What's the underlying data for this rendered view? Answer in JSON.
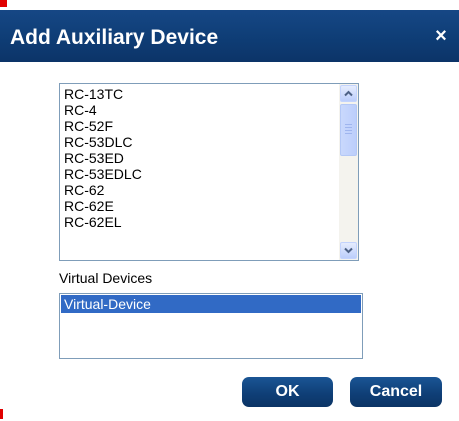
{
  "dialog": {
    "title": "Add Auxiliary Device",
    "close_symbol": "×",
    "colors": {
      "title_bar": "#0f3e77",
      "selection": "#316ac5",
      "button": "#0f3f77"
    }
  },
  "device_list": {
    "items": [
      "RC-13TC",
      "RC-4",
      "RC-52F",
      "RC-53DLC",
      "RC-53ED",
      "RC-53EDLC",
      "RC-62",
      "RC-62E",
      "RC-62EL"
    ],
    "scrollbar": {
      "up_icon": "chevron-up-icon",
      "down_icon": "chevron-down-icon"
    }
  },
  "virtual_devices": {
    "label": "Virtual Devices",
    "items": [
      "Virtual-Device"
    ],
    "selected": "Virtual-Device"
  },
  "buttons": {
    "ok": "OK",
    "cancel": "Cancel"
  }
}
